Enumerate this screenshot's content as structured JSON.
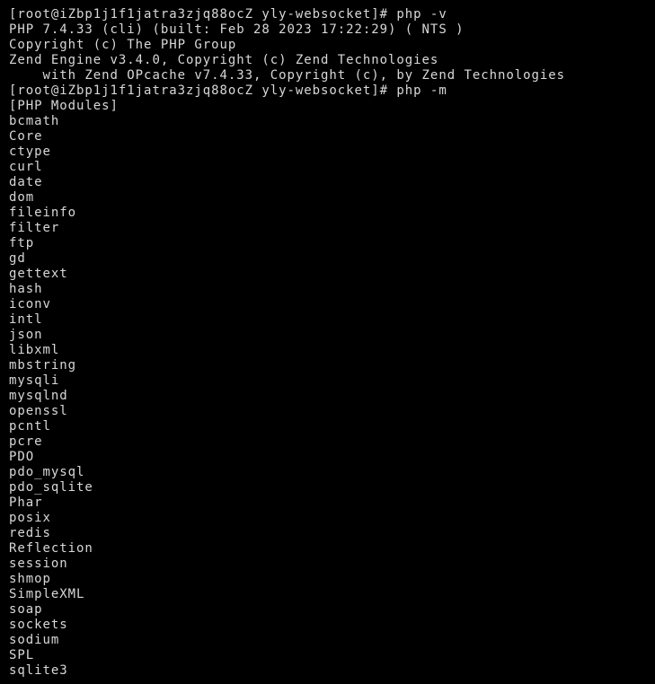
{
  "terminal": {
    "window_title": "root@iZbp1j1f1jatra3zjq88ocZ:~/yly-websocket",
    "background_color": "#000000",
    "foreground_color": "#d8d8d8",
    "prompt_user": "root",
    "prompt_host": "iZbp1j1f1jatra3zjq88ocZ",
    "prompt_cwd": "yly-websocket",
    "prompt_symbol": "#",
    "commands": [
      "php -v",
      "php -m"
    ],
    "lines": [
      "[root@iZbp1j1f1jatra3zjq88ocZ yly-websocket]# php -v",
      "PHP 7.4.33 (cli) (built: Feb 28 2023 17:22:29) ( NTS )",
      "Copyright (c) The PHP Group",
      "Zend Engine v3.4.0, Copyright (c) Zend Technologies",
      "    with Zend OPcache v7.4.33, Copyright (c), by Zend Technologies",
      "[root@iZbp1j1f1jatra3zjq88ocZ yly-websocket]# php -m",
      "[PHP Modules]",
      "bcmath",
      "Core",
      "ctype",
      "curl",
      "date",
      "dom",
      "fileinfo",
      "filter",
      "ftp",
      "gd",
      "gettext",
      "hash",
      "iconv",
      "intl",
      "json",
      "libxml",
      "mbstring",
      "mysqli",
      "mysqlnd",
      "openssl",
      "pcntl",
      "pcre",
      "PDO",
      "pdo_mysql",
      "pdo_sqlite",
      "Phar",
      "posix",
      "redis",
      "Reflection",
      "session",
      "shmop",
      "SimpleXML",
      "soap",
      "sockets",
      "sodium",
      "SPL",
      "sqlite3"
    ],
    "php_version_info": {
      "version": "PHP 7.4.33",
      "sapi": "cli",
      "built": "Feb 28 2023 17:22:29",
      "thread_safety": "NTS",
      "copyright": "Copyright (c) The PHP Group",
      "zend_engine": "Zend Engine v3.4.0, Copyright (c) Zend Technologies",
      "opcache": "with Zend OPcache v7.4.33, Copyright (c), by Zend Technologies"
    },
    "modules_header": "[PHP Modules]",
    "modules": [
      "bcmath",
      "Core",
      "ctype",
      "curl",
      "date",
      "dom",
      "fileinfo",
      "filter",
      "ftp",
      "gd",
      "gettext",
      "hash",
      "iconv",
      "intl",
      "json",
      "libxml",
      "mbstring",
      "mysqli",
      "mysqlnd",
      "openssl",
      "pcntl",
      "pcre",
      "PDO",
      "pdo_mysql",
      "pdo_sqlite",
      "Phar",
      "posix",
      "redis",
      "Reflection",
      "session",
      "shmop",
      "SimpleXML",
      "soap",
      "sockets",
      "sodium",
      "SPL",
      "sqlite3"
    ]
  }
}
